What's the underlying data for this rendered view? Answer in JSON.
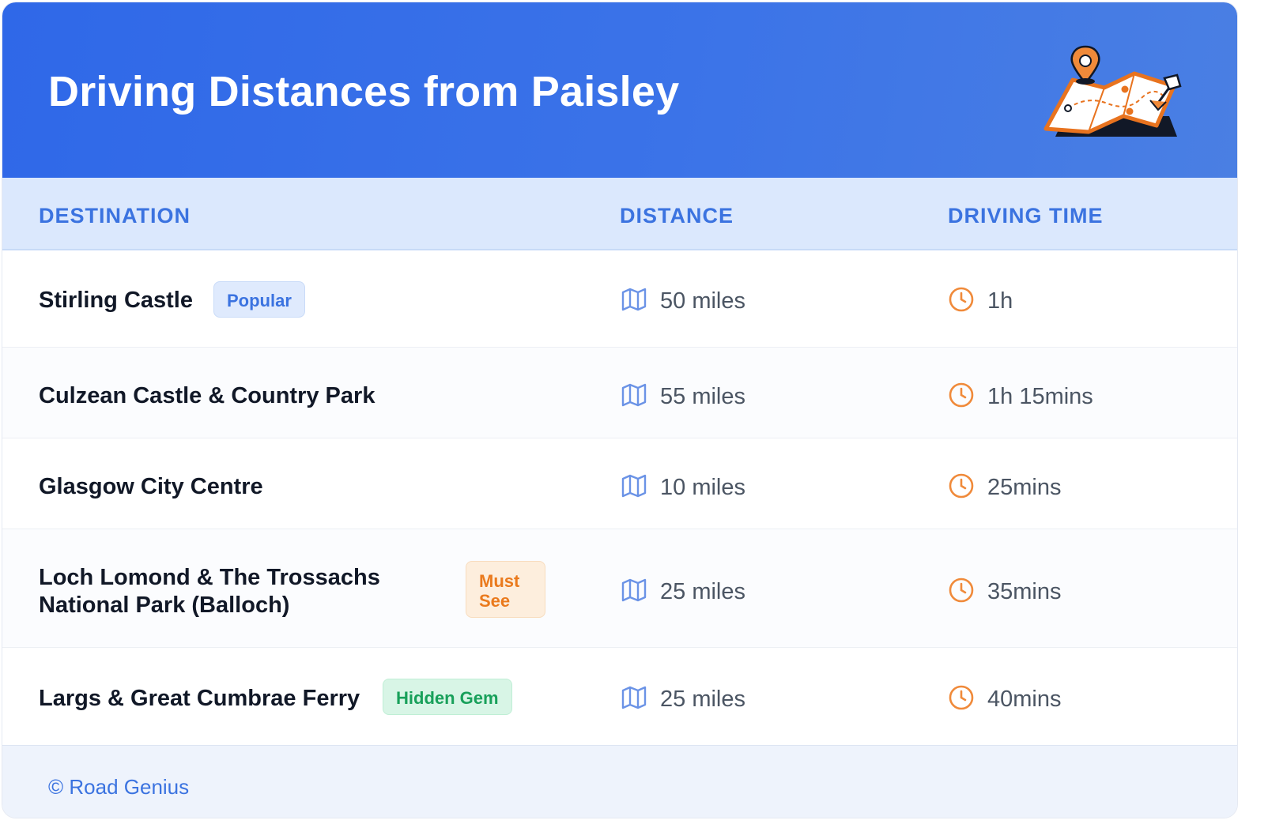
{
  "header": {
    "title": "Driving Distances from Paisley",
    "illustration_icon": "folded-map-with-pin-icon"
  },
  "columns": {
    "destination": "DESTINATION",
    "distance": "DISTANCE",
    "driving_time": "DRIVING TIME"
  },
  "rows": [
    {
      "destination": "Stirling Castle",
      "badge": "Popular",
      "badge_color": "#3b73e0",
      "distance": "50 miles",
      "time": "1h"
    },
    {
      "destination": "Culzean Castle & Country Park",
      "distance": "55 miles",
      "time": "1h 15mins"
    },
    {
      "destination": "Glasgow City Centre",
      "distance": "10 miles",
      "time": "25mins"
    },
    {
      "destination_line1": "Loch Lomond & The Trossachs",
      "destination_line2": "National Park (Balloch)",
      "badge_line1": "Must",
      "badge_line2": "See",
      "badge_color": "#ea7a1d",
      "distance": "25 miles",
      "time": "35mins"
    },
    {
      "destination": "Largs & Great Cumbrae Ferry",
      "badge": "Hidden Gem",
      "badge_color": "#18a05a",
      "distance": "25 miles",
      "time": "40mins"
    }
  ],
  "icons": {
    "distance": "map-icon",
    "time": "clock-icon"
  },
  "footer": {
    "credit": "© Road Genius"
  },
  "colors": {
    "header_bg": "#2f68e8",
    "accent": "#3b73e0",
    "clock": "#f08a3a"
  }
}
